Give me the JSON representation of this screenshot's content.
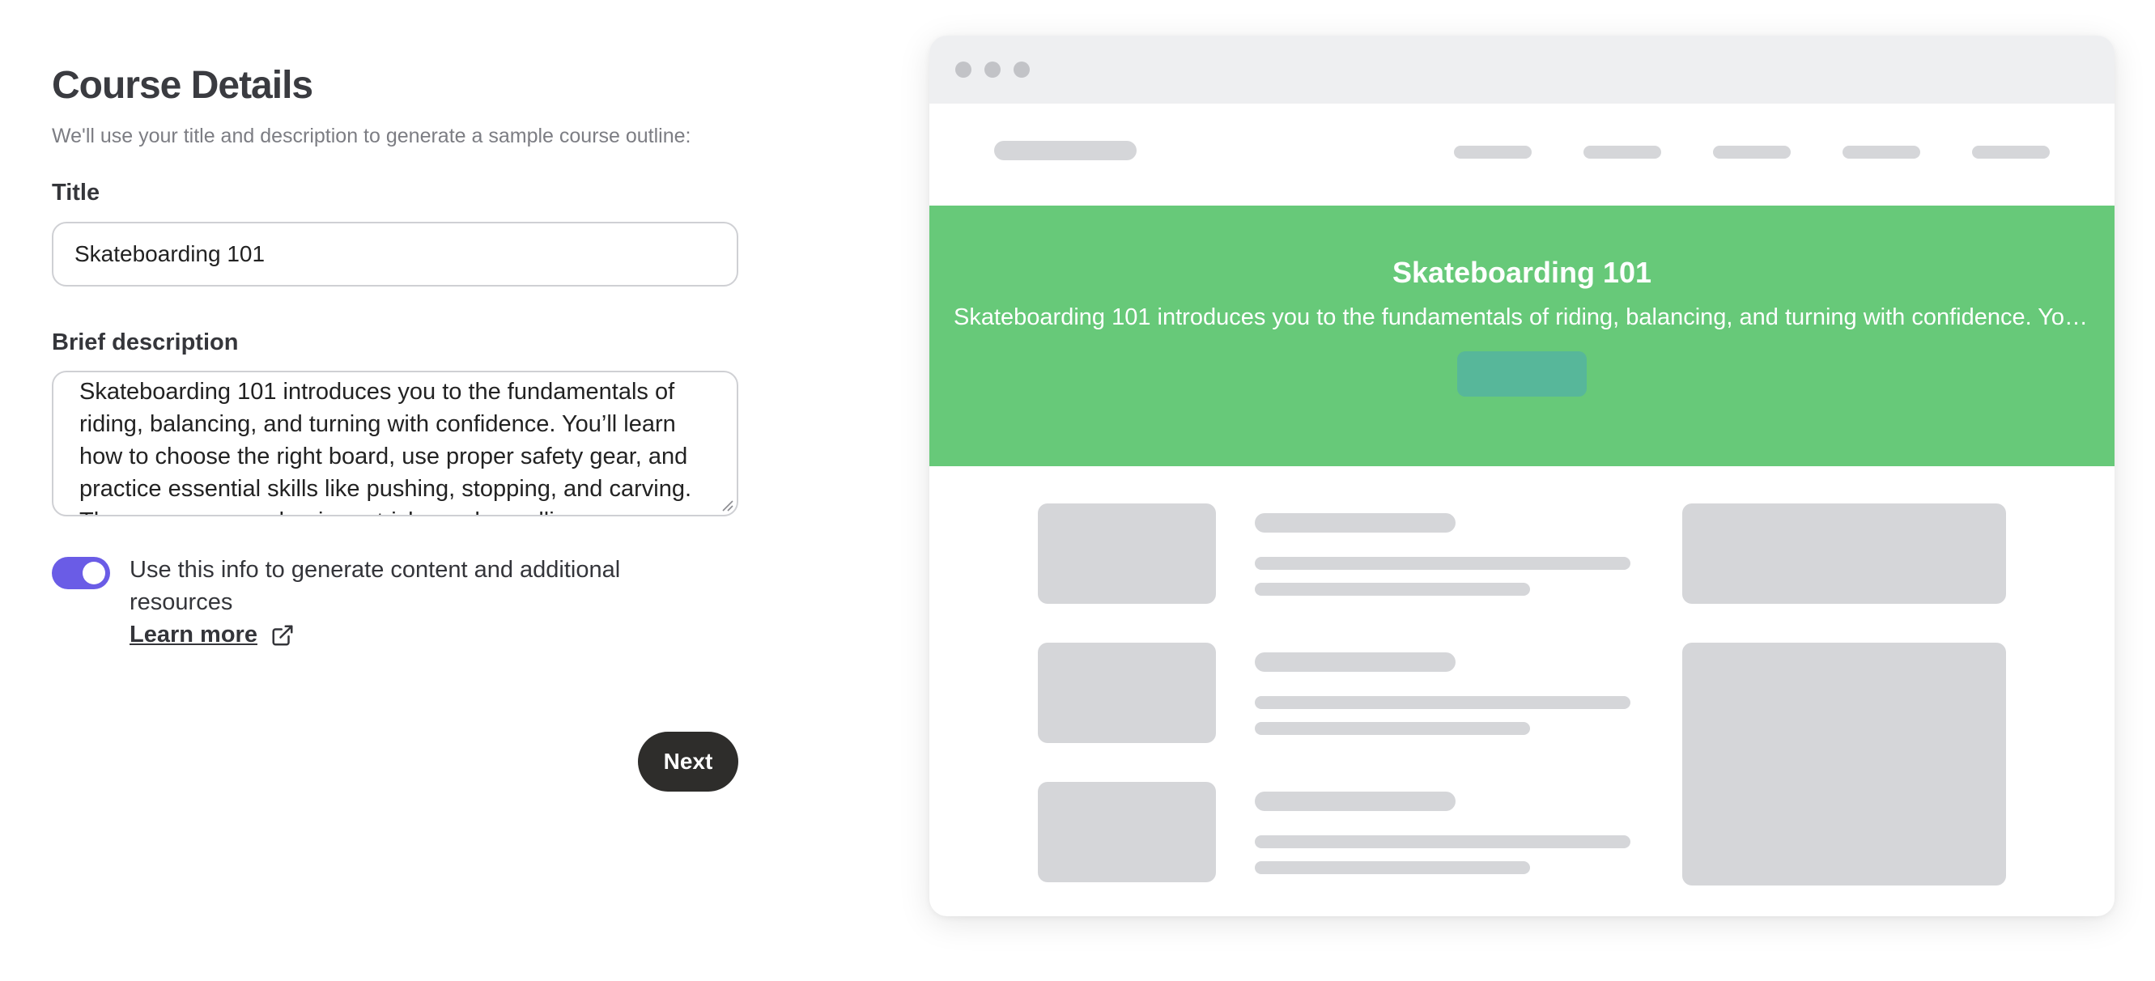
{
  "form": {
    "title": "Course Details",
    "subtitle": "We'll use your title and description to generate a sample course outline:",
    "title_label": "Title",
    "title_value": "Skateboarding 101",
    "description_label": "Brief description",
    "description_value": "Skateboarding 101 introduces you to the fundamentals of riding, balancing, and turning with confidence. You’ll learn how to choose the right board, use proper safety gear, and practice essential skills like pushing, stopping, and carving. The course covers beginner tricks such as ollies",
    "toggle_on": true,
    "toggle_label": "Use this info to generate content and additional resources",
    "learn_more_label": "Learn more",
    "next_label": "Next"
  },
  "preview": {
    "hero_title": "Skateboarding 101",
    "hero_description": "Skateboarding 101 introduces you to the fundamentals of riding, balancing, and turning with confidence. You’ll learn how to choose the right board, use proper safety gear, and practice essential skills",
    "hero_color": "#67c979",
    "hero_button_color": "#57b79a",
    "placeholder_color": "#d5d6d9"
  },
  "colors": {
    "toggle_accent": "#6a5ce6",
    "next_button_bg": "#2e2d2b"
  },
  "icons": {
    "learn_more": "external-link-icon",
    "window_controls": "window-dot-icon"
  }
}
